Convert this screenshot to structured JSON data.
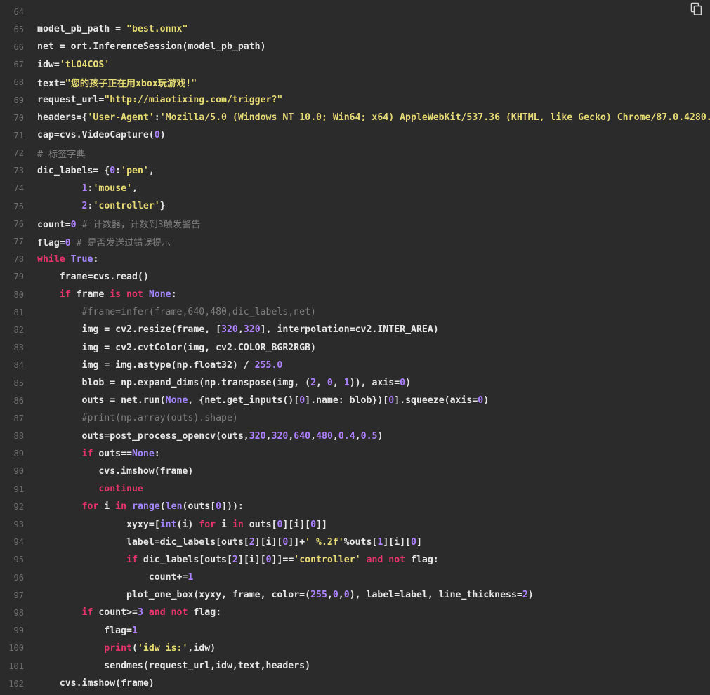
{
  "colors": {
    "background": "#2b2b2b",
    "line_number": "#6e6e6e",
    "text": "#e6e6e6",
    "keyword": "#e5336b",
    "string": "#e6db74",
    "number": "#ae81ff",
    "comment": "#7e7e7e",
    "builtin": "#a487ff"
  },
  "toolbar": {
    "copy_icon": "copy-icon"
  },
  "code": {
    "lines": [
      {
        "n": "64",
        "indent": "",
        "tokens": []
      },
      {
        "n": "65",
        "indent": "",
        "tokens": [
          [
            "tx",
            "model_pb_path = "
          ],
          [
            "str",
            "\"best.onnx\""
          ]
        ]
      },
      {
        "n": "66",
        "indent": "",
        "tokens": [
          [
            "tx",
            "net = ort.InferenceSession(model_pb_path)"
          ]
        ]
      },
      {
        "n": "67",
        "indent": "",
        "tokens": [
          [
            "tx",
            "idw="
          ],
          [
            "str",
            "'tLO4COS'"
          ]
        ]
      },
      {
        "n": "68",
        "indent": "",
        "tokens": [
          [
            "tx",
            "text="
          ],
          [
            "str",
            "\"您的孩子正在用xbox玩游戏!\""
          ]
        ]
      },
      {
        "n": "69",
        "indent": "",
        "tokens": [
          [
            "tx",
            "request_url="
          ],
          [
            "str",
            "\"http://miaotixing.com/trigger?\""
          ]
        ]
      },
      {
        "n": "70",
        "indent": "",
        "tokens": [
          [
            "tx",
            "headers={"
          ],
          [
            "str",
            "'User-Agent'"
          ],
          [
            "tx",
            ":"
          ],
          [
            "str",
            "'Mozilla/5.0 (Windows NT 10.0; Win64; x64) AppleWebKit/537.36 (KHTML, like Gecko) Chrome/87.0.4280."
          ]
        ]
      },
      {
        "n": "71",
        "indent": "",
        "tokens": [
          [
            "tx",
            "cap=cvs.VideoCapture("
          ],
          [
            "num",
            "0"
          ],
          [
            "tx",
            ")"
          ]
        ]
      },
      {
        "n": "72",
        "indent": "",
        "tokens": [
          [
            "com",
            "# 标签字典"
          ]
        ]
      },
      {
        "n": "73",
        "indent": "",
        "tokens": [
          [
            "tx",
            "dic_labels= {"
          ],
          [
            "num",
            "0"
          ],
          [
            "tx",
            ":"
          ],
          [
            "str",
            "'pen'"
          ],
          [
            "tx",
            ","
          ]
        ]
      },
      {
        "n": "74",
        "indent": "        ",
        "tokens": [
          [
            "num",
            "1"
          ],
          [
            "tx",
            ":"
          ],
          [
            "str",
            "'mouse'"
          ],
          [
            "tx",
            ","
          ]
        ]
      },
      {
        "n": "75",
        "indent": "        ",
        "tokens": [
          [
            "num",
            "2"
          ],
          [
            "tx",
            ":"
          ],
          [
            "str",
            "'controller'"
          ],
          [
            "tx",
            "}"
          ]
        ]
      },
      {
        "n": "76",
        "indent": "",
        "tokens": [
          [
            "tx",
            "count="
          ],
          [
            "num",
            "0"
          ],
          [
            "com",
            " # 计数器，计数到3触发警告"
          ]
        ]
      },
      {
        "n": "77",
        "indent": "",
        "tokens": [
          [
            "tx",
            "flag="
          ],
          [
            "num",
            "0"
          ],
          [
            "com",
            " # 是否发送过错误提示"
          ]
        ]
      },
      {
        "n": "78",
        "indent": "",
        "tokens": [
          [
            "kw",
            "while"
          ],
          [
            "tx",
            " "
          ],
          [
            "bi",
            "True"
          ],
          [
            "tx",
            ":"
          ]
        ]
      },
      {
        "n": "79",
        "indent": "    ",
        "tokens": [
          [
            "tx",
            "frame=cvs.read()"
          ]
        ]
      },
      {
        "n": "80",
        "indent": "    ",
        "tokens": [
          [
            "kw",
            "if"
          ],
          [
            "tx",
            " frame "
          ],
          [
            "kw",
            "is not"
          ],
          [
            "tx",
            " "
          ],
          [
            "bi",
            "None"
          ],
          [
            "tx",
            ":"
          ]
        ]
      },
      {
        "n": "81",
        "indent": "        ",
        "tokens": [
          [
            "com",
            "#frame=infer(frame,640,480,dic_labels,net)"
          ]
        ]
      },
      {
        "n": "82",
        "indent": "        ",
        "tokens": [
          [
            "tx",
            "img = cv2.resize(frame, ["
          ],
          [
            "num",
            "320"
          ],
          [
            "tx",
            ","
          ],
          [
            "num",
            "320"
          ],
          [
            "tx",
            "], interpolation=cv2.INTER_AREA)"
          ]
        ]
      },
      {
        "n": "83",
        "indent": "        ",
        "tokens": [
          [
            "tx",
            "img = cv2.cvtColor(img, cv2.COLOR_BGR2RGB)"
          ]
        ]
      },
      {
        "n": "84",
        "indent": "        ",
        "tokens": [
          [
            "tx",
            "img = img.astype(np.float32) / "
          ],
          [
            "num",
            "255.0"
          ]
        ]
      },
      {
        "n": "85",
        "indent": "        ",
        "tokens": [
          [
            "tx",
            "blob = np.expand_dims(np.transpose(img, ("
          ],
          [
            "num",
            "2"
          ],
          [
            "tx",
            ", "
          ],
          [
            "num",
            "0"
          ],
          [
            "tx",
            ", "
          ],
          [
            "num",
            "1"
          ],
          [
            "tx",
            ")), axis="
          ],
          [
            "num",
            "0"
          ],
          [
            "tx",
            ")"
          ]
        ]
      },
      {
        "n": "86",
        "indent": "        ",
        "tokens": [
          [
            "tx",
            "outs = net.run("
          ],
          [
            "bi",
            "None"
          ],
          [
            "tx",
            ", {net.get_inputs()["
          ],
          [
            "num",
            "0"
          ],
          [
            "tx",
            "].name: blob})["
          ],
          [
            "num",
            "0"
          ],
          [
            "tx",
            "].squeeze(axis="
          ],
          [
            "num",
            "0"
          ],
          [
            "tx",
            ")"
          ]
        ]
      },
      {
        "n": "87",
        "indent": "        ",
        "tokens": [
          [
            "com",
            "#print(np.array(outs).shape)"
          ]
        ]
      },
      {
        "n": "88",
        "indent": "        ",
        "tokens": [
          [
            "tx",
            "outs=post_process_opencv(outs,"
          ],
          [
            "num",
            "320"
          ],
          [
            "tx",
            ","
          ],
          [
            "num",
            "320"
          ],
          [
            "tx",
            ","
          ],
          [
            "num",
            "640"
          ],
          [
            "tx",
            ","
          ],
          [
            "num",
            "480"
          ],
          [
            "tx",
            ","
          ],
          [
            "num",
            "0.4"
          ],
          [
            "tx",
            ","
          ],
          [
            "num",
            "0.5"
          ],
          [
            "tx",
            ")"
          ]
        ]
      },
      {
        "n": "89",
        "indent": "        ",
        "tokens": [
          [
            "kw",
            "if"
          ],
          [
            "tx",
            " outs=="
          ],
          [
            "bi",
            "None"
          ],
          [
            "tx",
            ":"
          ]
        ]
      },
      {
        "n": "90",
        "indent": "           ",
        "tokens": [
          [
            "tx",
            "cvs.imshow(frame)"
          ]
        ]
      },
      {
        "n": "91",
        "indent": "           ",
        "tokens": [
          [
            "kw",
            "continue"
          ]
        ]
      },
      {
        "n": "92",
        "indent": "        ",
        "tokens": [
          [
            "kw",
            "for"
          ],
          [
            "tx",
            " i "
          ],
          [
            "kw",
            "in"
          ],
          [
            "tx",
            " "
          ],
          [
            "bi",
            "range"
          ],
          [
            "tx",
            "("
          ],
          [
            "bi",
            "len"
          ],
          [
            "tx",
            "(outs["
          ],
          [
            "num",
            "0"
          ],
          [
            "tx",
            "])):"
          ]
        ]
      },
      {
        "n": "93",
        "indent": "                ",
        "tokens": [
          [
            "tx",
            "xyxy=["
          ],
          [
            "bi",
            "int"
          ],
          [
            "tx",
            "(i) "
          ],
          [
            "kw",
            "for"
          ],
          [
            "tx",
            " i "
          ],
          [
            "kw",
            "in"
          ],
          [
            "tx",
            " outs["
          ],
          [
            "num",
            "0"
          ],
          [
            "tx",
            "][i]["
          ],
          [
            "num",
            "0"
          ],
          [
            "tx",
            "]]"
          ]
        ]
      },
      {
        "n": "94",
        "indent": "                ",
        "tokens": [
          [
            "tx",
            "label=dic_labels[outs["
          ],
          [
            "num",
            "2"
          ],
          [
            "tx",
            "][i]["
          ],
          [
            "num",
            "0"
          ],
          [
            "tx",
            "]]+"
          ],
          [
            "str",
            "' %.2f'"
          ],
          [
            "tx",
            "%outs["
          ],
          [
            "num",
            "1"
          ],
          [
            "tx",
            "][i]["
          ],
          [
            "num",
            "0"
          ],
          [
            "tx",
            "]"
          ]
        ]
      },
      {
        "n": "95",
        "indent": "                ",
        "tokens": [
          [
            "kw",
            "if"
          ],
          [
            "tx",
            " dic_labels[outs["
          ],
          [
            "num",
            "2"
          ],
          [
            "tx",
            "][i]["
          ],
          [
            "num",
            "0"
          ],
          [
            "tx",
            "]]=="
          ],
          [
            "str",
            "'controller'"
          ],
          [
            "tx",
            " "
          ],
          [
            "kw",
            "and not"
          ],
          [
            "tx",
            " flag:"
          ]
        ]
      },
      {
        "n": "96",
        "indent": "                    ",
        "tokens": [
          [
            "tx",
            "count+="
          ],
          [
            "num",
            "1"
          ]
        ]
      },
      {
        "n": "97",
        "indent": "                ",
        "tokens": [
          [
            "tx",
            "plot_one_box(xyxy, frame, color=("
          ],
          [
            "num",
            "255"
          ],
          [
            "tx",
            ","
          ],
          [
            "num",
            "0"
          ],
          [
            "tx",
            ","
          ],
          [
            "num",
            "0"
          ],
          [
            "tx",
            "), label=label, line_thickness="
          ],
          [
            "num",
            "2"
          ],
          [
            "tx",
            ")"
          ]
        ]
      },
      {
        "n": "98",
        "indent": "        ",
        "tokens": [
          [
            "kw",
            "if"
          ],
          [
            "tx",
            " count>="
          ],
          [
            "num",
            "3"
          ],
          [
            "tx",
            " "
          ],
          [
            "kw",
            "and not"
          ],
          [
            "tx",
            " flag:"
          ]
        ]
      },
      {
        "n": "99",
        "indent": "            ",
        "tokens": [
          [
            "tx",
            "flag="
          ],
          [
            "num",
            "1"
          ]
        ]
      },
      {
        "n": "100",
        "indent": "            ",
        "tokens": [
          [
            "kw",
            "print"
          ],
          [
            "tx",
            "("
          ],
          [
            "str",
            "'idw is:'"
          ],
          [
            "tx",
            ",idw)"
          ]
        ]
      },
      {
        "n": "101",
        "indent": "            ",
        "tokens": [
          [
            "tx",
            "sendmes(request_url,idw,text,headers)"
          ]
        ]
      },
      {
        "n": "102",
        "indent": "    ",
        "tokens": [
          [
            "tx",
            "cvs.imshow(frame)"
          ]
        ]
      }
    ]
  }
}
